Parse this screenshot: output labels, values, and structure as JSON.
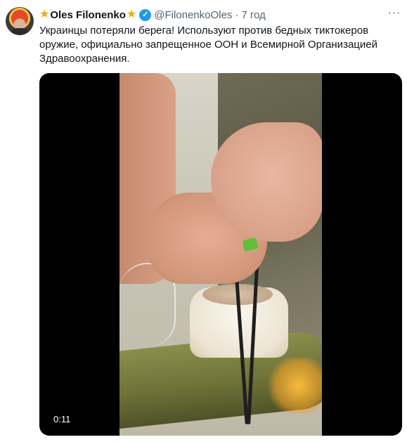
{
  "author": {
    "star_left": "★",
    "name": "Oles Filonenko",
    "star_right": "★",
    "verified_glyph": "✓",
    "handle": "@FilonenkoOles",
    "separator": "·",
    "time": "7 год"
  },
  "more_glyph": "···",
  "tweet": {
    "text": "Украинцы потеряли берега! Используют против бедных тиктокеров оружие, официально запрещенное ООН и Всемирной Организацией Здравоохранения."
  },
  "video": {
    "timestamp": "0:11"
  },
  "colors": {
    "accent": "#1d9bf0",
    "star": "#f2a900",
    "muted_text": "#536471"
  },
  "icons": [
    "avatar",
    "star-icon",
    "verified-badge-icon",
    "more-options-icon"
  ]
}
